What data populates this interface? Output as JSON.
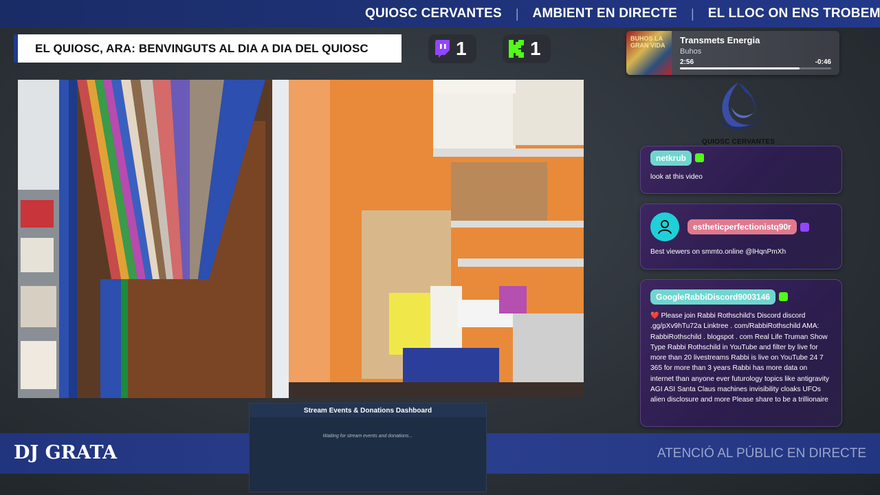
{
  "ticker": {
    "items": [
      "QUIOSC CERVANTES",
      "AMBIENT EN DIRECTE",
      "EL LLOC ON ENS TROBEM"
    ],
    "separator": "|"
  },
  "title_bar": {
    "text": "EL QUIOSC, ARA: BENVINGUTS AL DIA A DIA DEL QUIOSC"
  },
  "counters": [
    {
      "platform": "twitch-icon",
      "value": "1",
      "color": "#9146ff"
    },
    {
      "platform": "kick-icon",
      "value": "1",
      "color": "#53fc18"
    }
  ],
  "now_playing": {
    "art_text": "BUHOS LA GRAN VIDA",
    "title": "Transmets Energia",
    "artist": "Buhos",
    "elapsed": "2:56",
    "remaining": "-0:46",
    "progress": 0.79
  },
  "logo": {
    "text": "QUIOSC CERVANTES"
  },
  "chat": [
    {
      "username": "netkrub",
      "badge": "kick-icon",
      "message": "look at this video",
      "color": "#6fd6cf"
    },
    {
      "username": "estheticperfectionistq90r",
      "badge": "twitch-icon",
      "avatar": "user-avatar-icon",
      "message": "Best viewers on smmto.online @lHqnPmXh",
      "color": "#e0798e"
    },
    {
      "username": "GoogleRabbiDiscord9003146",
      "badge": "kick-icon",
      "message": "❤️ Please join Rabbi Rothschild's Discord discord .gg/pXv9hTu72a Linktree . com/RabbiRothschild AMA: RabbiRothschild . blogspot . com Real Life Truman Show Type Rabbi Rothschild in YouTube and filter by live for more than 20 livestreams Rabbi is live on YouTube 24 7 365 for more than 3 years Rabbi has more data on internet than anyone ever futurology topics like antigravity AGI ASI Santa Claus machines invisibility cloaks UFOs alien disclosure and more Please share to be a trillionaire",
      "color": "#6fd6cf"
    }
  ],
  "bottom_bar": {
    "dj": "DJ GRATA",
    "attention": "ATENCIÓ AL PÚBLIC EN DIRECTE"
  },
  "dashboard": {
    "title": "Stream Events & Donations Dashboard",
    "waiting": "Waiting for stream events and donations..."
  },
  "colors": {
    "accent_blue": "#23388a",
    "chat_bg": "#3d2660",
    "twitch": "#9146ff",
    "kick": "#53fc18"
  }
}
